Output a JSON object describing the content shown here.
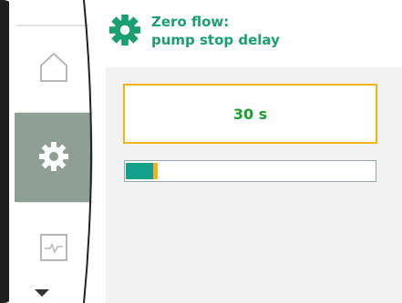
{
  "header": {
    "title_line1": "Zero flow:",
    "title_line2": "pump stop delay",
    "icon": "gear-icon"
  },
  "menu": {
    "items": [
      {
        "name": "home",
        "icon": "home-icon",
        "active": false
      },
      {
        "name": "settings",
        "icon": "gear-icon",
        "active": true
      },
      {
        "name": "diagnostics",
        "icon": "pulse-icon",
        "active": false
      }
    ],
    "scroll_icon": "chevron-down-icon"
  },
  "setting": {
    "value": "30 s",
    "progress_fraction": 0.12
  },
  "colors": {
    "accent_green": "#1aa06e",
    "value_green": "#1aa032",
    "focus_yellow": "#f2b21c",
    "bar_teal": "#12a08a",
    "active_menu_gray": "#8f9f95"
  }
}
